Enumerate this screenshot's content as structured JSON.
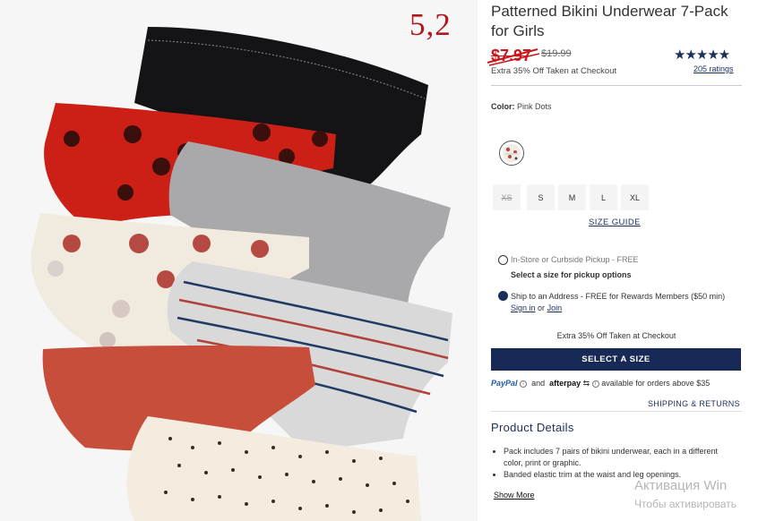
{
  "annotation": {
    "number": "5,2"
  },
  "product": {
    "title": "Patterned Bikini Underwear 7-Pack for Girls",
    "price_current": "$7.97",
    "price_original": "$19.99",
    "promo_note": "Extra 35% Off Taken at Checkout",
    "rating_stars": "★★★★★",
    "ratings_count": "205 ratings"
  },
  "color": {
    "label": "Color:",
    "value": "Pink Dots"
  },
  "sizes": [
    {
      "label": "XS",
      "available": false
    },
    {
      "label": "S",
      "available": true
    },
    {
      "label": "M",
      "available": true
    },
    {
      "label": "L",
      "available": true
    },
    {
      "label": "XL",
      "available": true
    }
  ],
  "size_guide": "SIZE GUIDE",
  "fulfillment": {
    "pickup_label": "In-Store or Curbside Pickup - FREE",
    "pickup_hint": "Select a size for pickup options",
    "ship_label": "Ship to an Address - FREE for Rewards Members ($50 min)",
    "sign_in": "Sign in",
    "or": "or",
    "join": "Join",
    "selected": "ship"
  },
  "checkout": {
    "promo_note": "Extra 35% Off Taken at Checkout",
    "select_button": "SELECT A SIZE",
    "paypal": "PayPal",
    "and": "and",
    "afterpay": "afterpay",
    "financing_note": "available for orders above $35",
    "shipping_link": "SHIPPING & RETURNS"
  },
  "details": {
    "title": "Product Details",
    "bullets": [
      "Pack includes 7 pairs of bikini underwear, each in a different color, print or graphic.",
      "Banded elastic trim at the waist and leg openings."
    ],
    "show_more": "Show More"
  },
  "os_watermark": {
    "line1": "Активация Win",
    "line2": "Чтобы активировать"
  },
  "colors": {
    "navy": "#162a55",
    "sale_red": "#c8181e",
    "annotation_red": "#b3161d"
  }
}
